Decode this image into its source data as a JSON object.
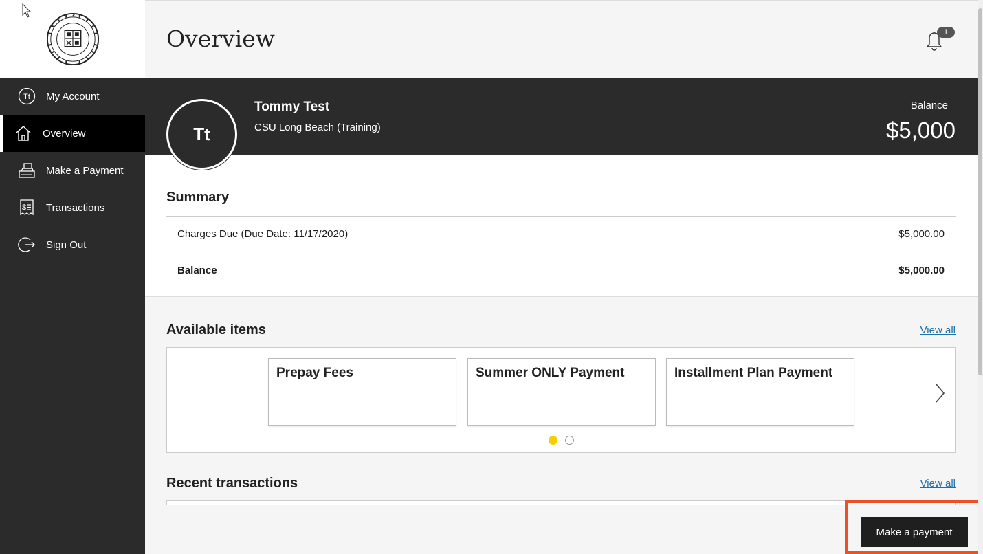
{
  "sidebar": {
    "items": [
      {
        "label": "My Account",
        "icon": "tt-circle-icon"
      },
      {
        "label": "Overview",
        "icon": "home-icon",
        "active": true
      },
      {
        "label": "Make a Payment",
        "icon": "cash-register-icon"
      },
      {
        "label": "Transactions",
        "icon": "receipt-icon"
      },
      {
        "label": "Sign Out",
        "icon": "sign-out-icon"
      }
    ],
    "account_initials": "Tt"
  },
  "header": {
    "title": "Overview",
    "notification_count": "1"
  },
  "profile": {
    "initials": "Tt",
    "name": "Tommy Test",
    "school": "CSU Long Beach (Training)",
    "balance_label": "Balance",
    "balance_amount": "$5,000"
  },
  "summary": {
    "title": "Summary",
    "rows": [
      {
        "label": "Charges Due (Due Date: 11/17/2020)",
        "amount": "$5,000.00"
      },
      {
        "label": "Balance",
        "amount": "$5,000.00"
      }
    ]
  },
  "available_items": {
    "title": "Available items",
    "view_all": "View all",
    "cards": [
      "Prepay Fees",
      "Summer ONLY Payment",
      "Installment Plan Payment"
    ],
    "active_page": 1,
    "page_count": 2,
    "active_dot_color": "#f5cf00"
  },
  "recent_transactions": {
    "title": "Recent transactions",
    "view_all": "View all"
  },
  "footer": {
    "pay_button": "Make a payment",
    "highlight_color": "#f04e23"
  }
}
